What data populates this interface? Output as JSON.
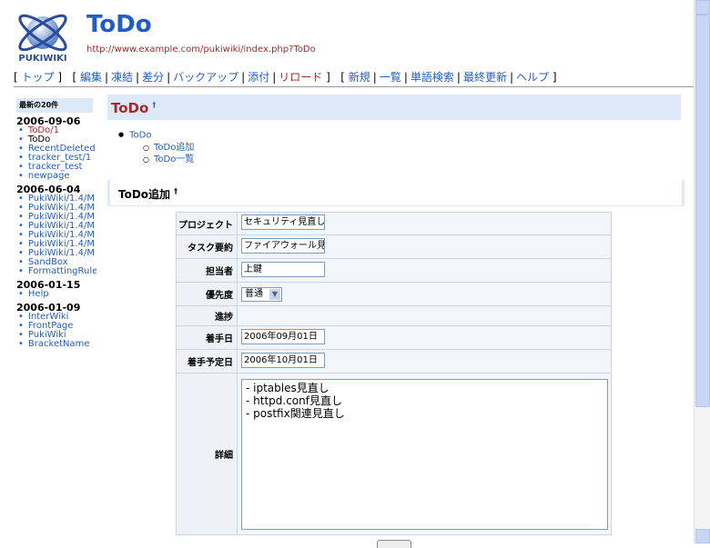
{
  "header": {
    "logo_text": "PUKIWIKI",
    "title": "ToDo",
    "url": "http://www.example.com/pukiwiki/index.php?ToDo"
  },
  "nav": {
    "group1": [
      "トップ"
    ],
    "group2": [
      "編集",
      "凍結",
      "差分",
      "バックアップ",
      "添付",
      "リロード"
    ],
    "group3": [
      "新規",
      "一覧",
      "単語検索",
      "最終更新",
      "ヘルプ"
    ]
  },
  "menu": {
    "heading": "最新の20件",
    "groups": [
      {
        "date": "2006-09-06",
        "items": [
          "ToDo/1",
          "ToDo",
          "RecentDeleted",
          "tracker_test/1",
          "tracker_test",
          "newpage"
        ]
      },
      {
        "date": "2006-06-04",
        "items": [
          "PukiWiki/1.4/M",
          "PukiWiki/1.4/M",
          "PukiWiki/1.4/M",
          "PukiWiki/1.4/M",
          "PukiWiki/1.4/M",
          "PukiWiki/1.4/M",
          "PukiWiki/1.4/M",
          "SandBox",
          "FormattingRule"
        ]
      },
      {
        "date": "2006-01-15",
        "items": [
          "Help"
        ]
      },
      {
        "date": "2006-01-09",
        "items": [
          "InterWiki",
          "FrontPage",
          "PukiWiki",
          "BracketName"
        ]
      }
    ]
  },
  "main": {
    "h2": "ToDo",
    "anchor": "†",
    "toc": {
      "top": "ToDo",
      "children": [
        "ToDo追加",
        "ToDo一覧"
      ]
    },
    "h3_prefix": "ToDo",
    "h3_suffix": "追加",
    "form": {
      "project_label": "プロジェクト",
      "project_value": "セキュリティ見直し",
      "summary_label": "タスク要約",
      "summary_value": "ファイアウォール見直し",
      "owner_label": "担当者",
      "owner_value": "上鍵",
      "priority_label": "優先度",
      "priority_value": "普通",
      "progress_label": "進捗",
      "start_label": "着手日",
      "start_value": "2006年09月01日",
      "plan_label": "着手予定日",
      "plan_value": "2006年10月01日",
      "detail_label": "詳細",
      "detail_lines": [
        "- iptables見直し",
        "- httpd.conf見直し",
        "- postfix関連見直し"
      ]
    }
  },
  "colors": {
    "link": "#215dc6",
    "visited": "#a52a2a",
    "heading_bg": "#dde9f7"
  }
}
